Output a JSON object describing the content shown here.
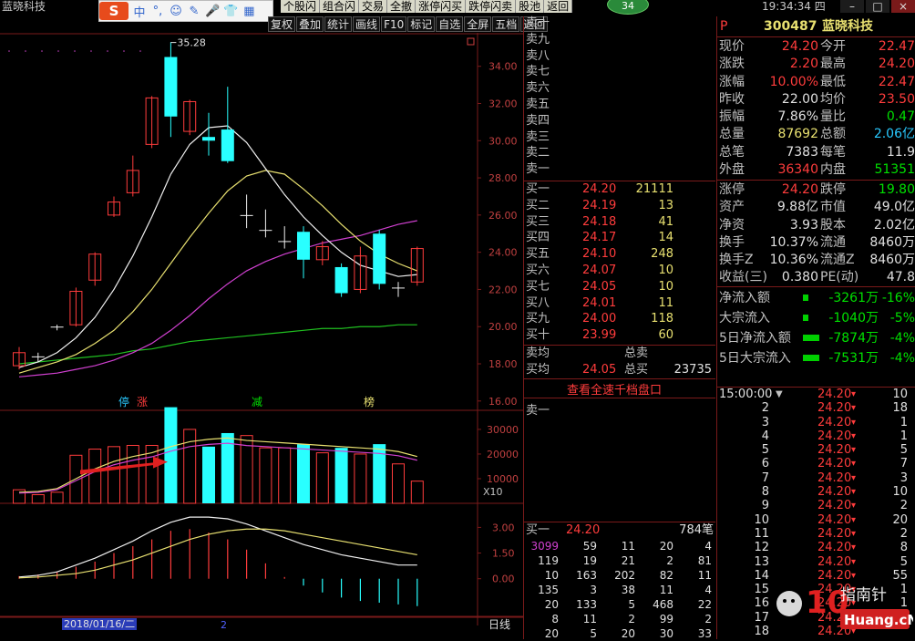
{
  "app_title": "蓝晓科技",
  "ime": {
    "logo": "S",
    "buttons": [
      "中",
      "°,",
      "☺",
      "✎",
      "🎤",
      "👕",
      "▦"
    ]
  },
  "quickbar": [
    "个股闪",
    "组合闪",
    "交易",
    "全撤",
    "涨停闪买",
    "跌停闪卖",
    "股池",
    "返回"
  ],
  "badge": "34",
  "clock": "19:34:34 四",
  "toolbar": [
    "复权",
    "叠加",
    "统计",
    "画线",
    "F10",
    "标记",
    "自选",
    "全屏",
    "五档",
    "返回"
  ],
  "price_axis": [
    "34.00",
    "32.00",
    "30.00",
    "28.00",
    "26.00",
    "24.00",
    "22.00",
    "20.00",
    "18.00",
    "16.00"
  ],
  "high_label": "35.28",
  "markers": [
    "停",
    "涨",
    "减",
    "榜"
  ],
  "vol_axis": [
    "30000",
    "20000",
    "10000"
  ],
  "vol_unit": "X10",
  "macd_axis": [
    "3.00",
    "1.50",
    "0.00"
  ],
  "date_label": "2018/01/16/二",
  "date_tick": "2",
  "period_label": "日线",
  "chart_data": {
    "type": "candlestick",
    "ylim": [
      15.5,
      35.8
    ],
    "high_label_value": 35.28,
    "candles": [
      {
        "o": 17.9,
        "c": 18.6,
        "h": 18.9,
        "l": 17.7
      },
      {
        "o": 18.3,
        "c": 18.4,
        "h": 18.6,
        "l": 18.1
      },
      {
        "o": 19.9,
        "c": 20.0,
        "h": 20.1,
        "l": 19.8
      },
      {
        "o": 20.1,
        "c": 21.9,
        "h": 22.1,
        "l": 20.0
      },
      {
        "o": 22.5,
        "c": 23.9,
        "h": 24.0,
        "l": 22.2
      },
      {
        "o": 26.0,
        "c": 26.7,
        "h": 27.0,
        "l": 25.9
      },
      {
        "o": 27.2,
        "c": 28.4,
        "h": 29.2,
        "l": 27.0
      },
      {
        "o": 29.8,
        "c": 32.3,
        "h": 32.4,
        "l": 29.6
      },
      {
        "o": 34.5,
        "c": 31.3,
        "h": 35.3,
        "l": 30.2
      },
      {
        "o": 30.5,
        "c": 32.1,
        "h": 32.2,
        "l": 30.3
      },
      {
        "o": 30.2,
        "c": 30.0,
        "h": 31.5,
        "l": 29.2
      },
      {
        "o": 30.6,
        "c": 28.9,
        "h": 32.9,
        "l": 28.8
      },
      {
        "o": 26.0,
        "c": 26.0,
        "h": 27.1,
        "l": 25.3
      },
      {
        "o": 25.2,
        "c": 25.2,
        "h": 26.3,
        "l": 24.8
      },
      {
        "o": 24.6,
        "c": 24.6,
        "h": 25.4,
        "l": 24.2
      },
      {
        "o": 25.1,
        "c": 23.6,
        "h": 25.4,
        "l": 22.6
      },
      {
        "o": 23.6,
        "c": 24.3,
        "h": 24.6,
        "l": 23.3
      },
      {
        "o": 23.2,
        "c": 21.8,
        "h": 23.4,
        "l": 21.6
      },
      {
        "o": 22.0,
        "c": 23.8,
        "h": 24.3,
        "l": 21.8
      },
      {
        "o": 25.0,
        "c": 22.3,
        "h": 25.2,
        "l": 22.0
      },
      {
        "o": 22.0,
        "c": 22.1,
        "h": 22.4,
        "l": 21.6
      },
      {
        "o": 22.4,
        "c": 24.2,
        "h": 24.3,
        "l": 22.2
      }
    ],
    "ma_white": [
      17.8,
      18.1,
      18.6,
      19.4,
      20.5,
      22.0,
      23.8,
      25.9,
      28.2,
      29.8,
      30.7,
      30.8,
      29.9,
      28.5,
      27.1,
      25.9,
      24.9,
      24.0,
      23.3,
      23.0,
      22.7,
      22.8
    ],
    "ma_yellow": [
      17.5,
      17.8,
      18.1,
      18.5,
      19.1,
      19.8,
      20.8,
      22.0,
      23.4,
      24.8,
      26.1,
      27.3,
      28.1,
      28.4,
      28.2,
      27.4,
      26.5,
      25.5,
      24.6,
      23.9,
      23.4,
      23.0
    ],
    "ma_magenta": [
      17.3,
      17.4,
      17.5,
      17.7,
      17.9,
      18.2,
      18.6,
      19.1,
      19.8,
      20.6,
      21.5,
      22.3,
      23.0,
      23.5,
      23.9,
      24.2,
      24.5,
      24.7,
      24.9,
      25.2,
      25.5,
      25.7
    ],
    "ma_green": [
      18.0,
      18.1,
      18.2,
      18.3,
      18.4,
      18.5,
      18.7,
      18.8,
      19.0,
      19.2,
      19.3,
      19.4,
      19.5,
      19.6,
      19.7,
      19.8,
      19.9,
      19.9,
      20.0,
      20.0,
      20.1,
      20.1
    ],
    "volume": [
      5500,
      3500,
      4500,
      19500,
      22000,
      23000,
      23500,
      23500,
      39000,
      30000,
      23000,
      28500,
      27500,
      22500,
      22500,
      24000,
      20500,
      22500,
      20000,
      24000,
      16000,
      9000
    ],
    "vol_ylim": [
      0,
      37000
    ],
    "vol_ma": [
      4500,
      4800,
      6000,
      10000,
      14000,
      17000,
      19000,
      20500,
      23000,
      25000,
      26000,
      26500,
      25500,
      25000,
      24500,
      24000,
      23500,
      23000,
      22500,
      22000,
      21000,
      19000
    ],
    "macd_hist": [
      0.15,
      0.25,
      0.4,
      0.7,
      1.0,
      1.5,
      1.9,
      2.3,
      2.8,
      2.9,
      2.7,
      2.3,
      1.7,
      0.9,
      0.1,
      -0.4,
      -0.8,
      -1.1,
      -1.3,
      -1.4,
      -1.5,
      -1.6
    ],
    "macd_dif": [
      0.1,
      0.2,
      0.4,
      0.8,
      1.2,
      1.7,
      2.2,
      2.8,
      3.3,
      3.6,
      3.6,
      3.5,
      3.2,
      2.8,
      2.4,
      2.0,
      1.7,
      1.4,
      1.2,
      1.0,
      0.8,
      0.8
    ],
    "macd_dea": [
      0.05,
      0.1,
      0.2,
      0.3,
      0.5,
      0.8,
      1.1,
      1.5,
      1.9,
      2.3,
      2.6,
      2.8,
      2.9,
      2.9,
      2.8,
      2.6,
      2.4,
      2.2,
      2.0,
      1.8,
      1.6,
      1.4
    ],
    "macd_ylim": [
      -2.2,
      4.3
    ]
  },
  "order_book": {
    "sells": [
      "卖十",
      "卖九",
      "卖八",
      "卖七",
      "卖六",
      "卖五",
      "卖四",
      "卖三",
      "卖二",
      "卖一"
    ],
    "buys": [
      {
        "label": "买一",
        "price": "24.20",
        "vol": "21111"
      },
      {
        "label": "买二",
        "price": "24.19",
        "vol": "13"
      },
      {
        "label": "买三",
        "price": "24.18",
        "vol": "41"
      },
      {
        "label": "买四",
        "price": "24.17",
        "vol": "14"
      },
      {
        "label": "买五",
        "price": "24.10",
        "vol": "248"
      },
      {
        "label": "买六",
        "price": "24.07",
        "vol": "10"
      },
      {
        "label": "买七",
        "price": "24.05",
        "vol": "10"
      },
      {
        "label": "买八",
        "price": "24.01",
        "vol": "11"
      },
      {
        "label": "买九",
        "price": "24.00",
        "vol": "118"
      },
      {
        "label": "买十",
        "price": "23.99",
        "vol": "60"
      }
    ],
    "sell_avg_label": "卖均",
    "sell_total_label": "总卖",
    "buy_avg_label": "买均",
    "buy_avg": "24.05",
    "buy_total_label": "总买",
    "buy_total": "23735",
    "view_link": "查看全速千档盘口",
    "sell1_label": "卖一",
    "buy1_label": "买一",
    "buy1_price": "24.20",
    "buy1_orders": "784笔",
    "queue": [
      [
        "3099",
        "59",
        "11",
        "20",
        "4"
      ],
      [
        "119",
        "19",
        "21",
        "2",
        "81"
      ],
      [
        "10",
        "163",
        "202",
        "82",
        "11"
      ],
      [
        "135",
        "3",
        "38",
        "11",
        "4"
      ],
      [
        "20",
        "133",
        "5",
        "468",
        "22"
      ],
      [
        "8",
        "11",
        "2",
        "99",
        "2"
      ],
      [
        "20",
        "5",
        "20",
        "30",
        "33"
      ]
    ]
  },
  "quote": {
    "flag": "P",
    "code": "300487",
    "name": "蓝晓科技",
    "rows1": [
      {
        "l1": "现价",
        "v1": "24.20",
        "l2": "今开",
        "v2": "22.47"
      },
      {
        "l1": "涨跌",
        "v1": "2.20",
        "l2": "最高",
        "v2": "24.20"
      },
      {
        "l1": "涨幅",
        "v1": "10.00%",
        "l2": "最低",
        "v2": "22.47"
      },
      {
        "l1": "昨收",
        "v1": "22.00",
        "l2": "均价",
        "v2": "23.50"
      },
      {
        "l1": "振幅",
        "v1": "7.86%",
        "l2": "量比",
        "v2": "0.47"
      },
      {
        "l1": "总量",
        "v1": "87692",
        "l2": "总额",
        "v2": "2.06亿"
      },
      {
        "l1": "总笔",
        "v1": "7383",
        "l2": "每笔",
        "v2": "11.9"
      },
      {
        "l1": "外盘",
        "v1": "36340",
        "l2": "内盘",
        "v2": "51351"
      }
    ],
    "rows2": [
      {
        "l1": "涨停",
        "v1": "24.20",
        "l2": "跌停",
        "v2": "19.80"
      },
      {
        "l1": "资产",
        "v1": "9.88亿",
        "l2": "市值",
        "v2": "49.0亿"
      },
      {
        "l1": "净资",
        "v1": "3.93",
        "l2": "股本",
        "v2": "2.02亿"
      },
      {
        "l1": "换手",
        "v1": "10.37%",
        "l2": "流通",
        "v2": "8460万"
      },
      {
        "l1": "换手Z",
        "v1": "10.36%",
        "l2": "流通Z",
        "v2": "8460万"
      },
      {
        "l1": "收益(三)",
        "v1": "0.380",
        "l2": "PE(动)",
        "v2": "47.8"
      }
    ],
    "flows": [
      {
        "label": "净流入额",
        "value": "-3261万",
        "pct": "-16%",
        "bar": 0.15
      },
      {
        "label": "大宗流入",
        "value": "-1040万",
        "pct": "-5%",
        "bar": 0.08
      },
      {
        "label": "5日净流入额",
        "value": "-7874万",
        "pct": "-4%",
        "bar": 0.55
      },
      {
        "label": "5日大宗流入",
        "value": "-7531万",
        "pct": "-4%",
        "bar": 0.55
      }
    ]
  },
  "ticks": {
    "header_time": "15:00:00",
    "header_arrow": "▼",
    "rows": [
      {
        "n": "",
        "p": "24.20",
        "v": "10"
      },
      {
        "n": "2",
        "p": "24.20",
        "v": "18"
      },
      {
        "n": "3",
        "p": "24.20",
        "v": "1"
      },
      {
        "n": "4",
        "p": "24.20",
        "v": "1"
      },
      {
        "n": "5",
        "p": "24.20",
        "v": "5"
      },
      {
        "n": "6",
        "p": "24.20",
        "v": "7"
      },
      {
        "n": "7",
        "p": "24.20",
        "v": "3"
      },
      {
        "n": "8",
        "p": "24.20",
        "v": "10"
      },
      {
        "n": "9",
        "p": "24.20",
        "v": "2"
      },
      {
        "n": "10",
        "p": "24.20",
        "v": "20"
      },
      {
        "n": "11",
        "p": "24.20",
        "v": "2"
      },
      {
        "n": "12",
        "p": "24.20",
        "v": "8"
      },
      {
        "n": "13",
        "p": "24.20",
        "v": "5"
      },
      {
        "n": "14",
        "p": "24.20",
        "v": "55"
      },
      {
        "n": "15",
        "p": "24.20",
        "v": "1"
      },
      {
        "n": "16",
        "p": "24.20",
        "v": "1"
      },
      {
        "n": "17",
        "p": "24.20",
        "v": "1"
      },
      {
        "n": "18",
        "p": "24.20",
        "v": ""
      }
    ]
  },
  "watermark": {
    "top": "指南针",
    "bottom": "Huang.cN",
    "digits": "10"
  }
}
